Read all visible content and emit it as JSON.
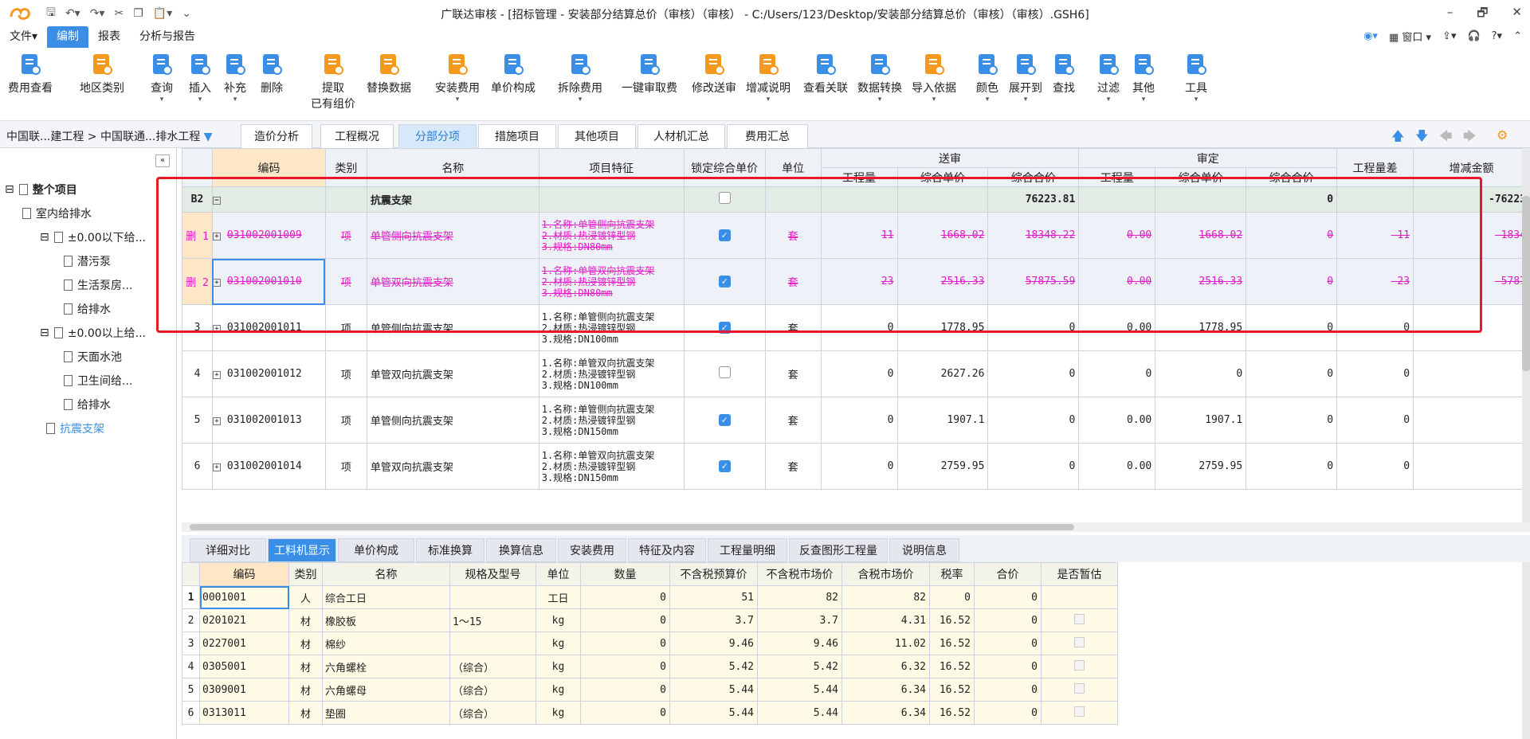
{
  "app": {
    "title": "广联达审核 - [招标管理 - 安装部分结算总价（审核）（审核） - C:/Users/123/Desktop/安装部分结算总价（审核）（审核）.GSH6]",
    "window_controls": [
      "–",
      "🗗",
      "✕"
    ]
  },
  "menus": [
    "文件▾",
    "编制",
    "报表",
    "分析与报告"
  ],
  "right_tools": [
    "窗口 ▾"
  ],
  "ribbon": [
    {
      "label": "费用查看",
      "sub": "",
      "icon": "fee-view-icon"
    },
    {
      "label": "地区类别",
      "sub": "",
      "icon": "region-icon"
    },
    {
      "label": "查询",
      "sub": "▾",
      "icon": "query-icon"
    },
    {
      "label": "插入",
      "sub": "▾",
      "icon": "insert-icon"
    },
    {
      "label": "补充",
      "sub": "▾",
      "icon": "supplement-icon"
    },
    {
      "label": "删除",
      "sub": "",
      "icon": "delete-icon"
    },
    {
      "label": "提取",
      "sub": "已有组价",
      "icon": "extract-icon"
    },
    {
      "label": "替换数据",
      "sub": "",
      "icon": "replace-icon"
    },
    {
      "label": "安装费用",
      "sub": "▾",
      "icon": "install-fee-icon"
    },
    {
      "label": "单价构成",
      "sub": "",
      "icon": "unit-price-icon"
    },
    {
      "label": "拆除费用",
      "sub": "▾",
      "icon": "demolish-icon"
    },
    {
      "label": "一键审取费",
      "sub": "",
      "icon": "one-click-icon"
    },
    {
      "label": "修改送审",
      "sub": "",
      "icon": "modify-icon"
    },
    {
      "label": "增减说明",
      "sub": "▾",
      "icon": "change-note-icon"
    },
    {
      "label": "查看关联",
      "sub": "",
      "icon": "relation-icon"
    },
    {
      "label": "数据转换",
      "sub": "▾",
      "icon": "convert-icon"
    },
    {
      "label": "导入依据",
      "sub": "▾",
      "icon": "import-icon"
    },
    {
      "label": "颜色",
      "sub": "▾",
      "icon": "color-icon"
    },
    {
      "label": "展开到",
      "sub": "▾",
      "icon": "expand-icon"
    },
    {
      "label": "查找",
      "sub": "",
      "icon": "find-icon"
    },
    {
      "label": "过滤",
      "sub": "▾",
      "icon": "filter-icon"
    },
    {
      "label": "其他",
      "sub": "▾",
      "icon": "other-icon"
    },
    {
      "label": "工具",
      "sub": "▾",
      "icon": "tools-icon"
    }
  ],
  "breadcrumb": "中国联...建工程 > 中国联通...排水工程",
  "page_tabs": [
    "造价分析",
    "工程概况",
    "分部分项",
    "措施项目",
    "其他项目",
    "人材机汇总",
    "费用汇总"
  ],
  "tree": [
    {
      "label": "整个项目",
      "level": 0,
      "toggle": "⊟",
      "bold": true
    },
    {
      "label": "室内给排水",
      "level": 1,
      "toggle": ""
    },
    {
      "label": "±0.00以下给...",
      "level": 2,
      "toggle": "⊟"
    },
    {
      "label": "潜污泵",
      "level": 3,
      "toggle": ""
    },
    {
      "label": "生活泵房...",
      "level": 3,
      "toggle": ""
    },
    {
      "label": "给排水",
      "level": 3,
      "toggle": ""
    },
    {
      "label": "±0.00以上给...",
      "level": 2,
      "toggle": "⊟"
    },
    {
      "label": "天面水池",
      "level": 3,
      "toggle": ""
    },
    {
      "label": "卫生间给...",
      "level": 3,
      "toggle": ""
    },
    {
      "label": "给排水",
      "level": 3,
      "toggle": ""
    },
    {
      "label": "抗震支架",
      "level": 1,
      "toggle": "",
      "selected": true
    }
  ],
  "grid": {
    "headers": {
      "code": "编码",
      "type": "类别",
      "name": "名称",
      "feature": "项目特征",
      "lock": "锁定综合单价",
      "unit": "单位",
      "sent": "送审",
      "audit": "审定",
      "qty": "工程量",
      "uprice": "综合单价",
      "total": "综合合价",
      "qtydiff": "工程量差",
      "incr": "增减金额"
    },
    "group": {
      "id": "B2",
      "name": "抗震支架",
      "sent_total": "76223.81",
      "audit_total": "0",
      "incr": "-76223"
    },
    "rows": [
      {
        "idx": "删 1",
        "code": "031002001009",
        "type": "项",
        "name": "单管侧向抗震支架",
        "feat": [
          "1.名称:单管侧向抗震支架",
          "2.材质:热浸镀锌型钢",
          "3.规格:DN80mm"
        ],
        "lock": true,
        "unit": "套",
        "sq": "11",
        "sp": "1668.02",
        "st": "18348.22",
        "aq": "0.00",
        "ap": "1668.02",
        "at": "0",
        "qd": "-11",
        "inc": "-1834",
        "deleted": true
      },
      {
        "idx": "删 2",
        "code": "031002001010",
        "type": "项",
        "name": "单管双向抗震支架",
        "feat": [
          "1.名称:单管双向抗震支架",
          "2.材质:热浸镀锌型钢",
          "3.规格:DN80mm"
        ],
        "lock": true,
        "unit": "套",
        "sq": "23",
        "sp": "2516.33",
        "st": "57875.59",
        "aq": "0.00",
        "ap": "2516.33",
        "at": "0",
        "qd": "-23",
        "inc": "-5787",
        "deleted": true
      },
      {
        "idx": "3",
        "code": "031002001011",
        "type": "项",
        "name": "单管侧向抗震支架",
        "feat": [
          "1.名称:单管侧向抗震支架",
          "2.材质:热浸镀锌型钢",
          "3.规格:DN100mm"
        ],
        "lock": true,
        "unit": "套",
        "sq": "0",
        "sp": "1778.95",
        "st": "0",
        "aq": "0.00",
        "ap": "1778.95",
        "at": "0",
        "qd": "0",
        "inc": "",
        "deleted": false
      },
      {
        "idx": "4",
        "code": "031002001012",
        "type": "项",
        "name": "单管双向抗震支架",
        "feat": [
          "1.名称:单管双向抗震支架",
          "2.材质:热浸镀锌型钢",
          "3.规格:DN100mm"
        ],
        "lock": false,
        "unit": "套",
        "sq": "0",
        "sp": "2627.26",
        "st": "0",
        "aq": "0",
        "ap": "0",
        "at": "0",
        "qd": "0",
        "inc": "",
        "deleted": false
      },
      {
        "idx": "5",
        "code": "031002001013",
        "type": "项",
        "name": "单管侧向抗震支架",
        "feat": [
          "1.名称:单管侧向抗震支架",
          "2.材质:热浸镀锌型钢",
          "3.规格:DN150mm"
        ],
        "lock": true,
        "unit": "套",
        "sq": "0",
        "sp": "1907.1",
        "st": "0",
        "aq": "0.00",
        "ap": "1907.1",
        "at": "0",
        "qd": "0",
        "inc": "",
        "deleted": false
      },
      {
        "idx": "6",
        "code": "031002001014",
        "type": "项",
        "name": "单管双向抗震支架",
        "feat": [
          "1.名称:单管双向抗震支架",
          "2.材质:热浸镀锌型钢",
          "3.规格:DN150mm"
        ],
        "lock": true,
        "unit": "套",
        "sq": "0",
        "sp": "2759.95",
        "st": "0",
        "aq": "0.00",
        "ap": "2759.95",
        "at": "0",
        "qd": "0",
        "inc": "",
        "deleted": false
      }
    ]
  },
  "bottom_tabs": [
    "详细对比",
    "工料机显示",
    "单价构成",
    "标准换算",
    "换算信息",
    "安装费用",
    "特征及内容",
    "工程量明细",
    "反查图形工程量",
    "说明信息"
  ],
  "bottom_grid": {
    "headers": [
      "编码",
      "类别",
      "名称",
      "规格及型号",
      "单位",
      "数量",
      "不含税预算价",
      "不含税市场价",
      "含税市场价",
      "税率",
      "合价",
      "是否暂估"
    ],
    "rows": [
      [
        "1",
        "0001001",
        "人",
        "综合工日",
        "",
        "工日",
        "0",
        "51",
        "82",
        "82",
        "0",
        "0"
      ],
      [
        "2",
        "0201021",
        "材",
        "橡胶板",
        "1～15",
        "kg",
        "0",
        "3.7",
        "3.7",
        "4.31",
        "16.52",
        "0"
      ],
      [
        "3",
        "0227001",
        "材",
        "棉纱",
        "",
        "kg",
        "0",
        "9.46",
        "9.46",
        "11.02",
        "16.52",
        "0"
      ],
      [
        "4",
        "0305001",
        "材",
        "六角螺栓",
        "（综合）",
        "kg",
        "0",
        "5.42",
        "5.42",
        "6.32",
        "16.52",
        "0"
      ],
      [
        "5",
        "0309001",
        "材",
        "六角螺母",
        "（综合）",
        "kg",
        "0",
        "5.44",
        "5.44",
        "6.34",
        "16.52",
        "0"
      ],
      [
        "6",
        "0313011",
        "材",
        "垫圈",
        "（综合）",
        "kg",
        "0",
        "5.44",
        "5.44",
        "6.34",
        "16.52",
        "0"
      ]
    ]
  },
  "colors": {
    "accent": "#3a8ee6",
    "deleted": "#e11cc6",
    "highlight_box": "#e8182a"
  }
}
